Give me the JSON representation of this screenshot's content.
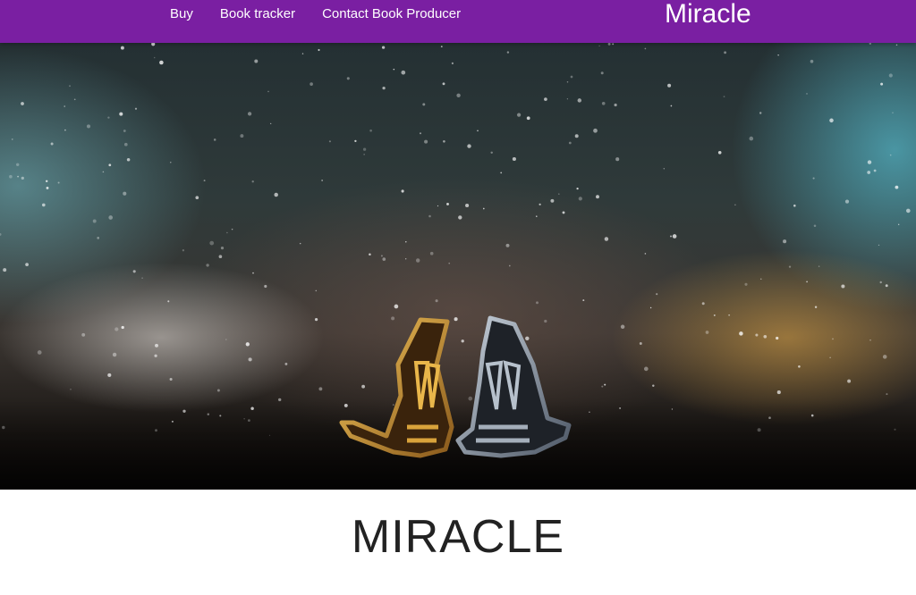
{
  "nav": {
    "links": [
      "Buy",
      "Book tracker",
      "Contact Book Producer"
    ],
    "brand": "Miracle",
    "background_color": "#7a1fa2"
  },
  "hero": {
    "image_description": "two ornate earrings on a wet surface with bokeh light"
  },
  "main": {
    "title": "MIRACLE"
  }
}
